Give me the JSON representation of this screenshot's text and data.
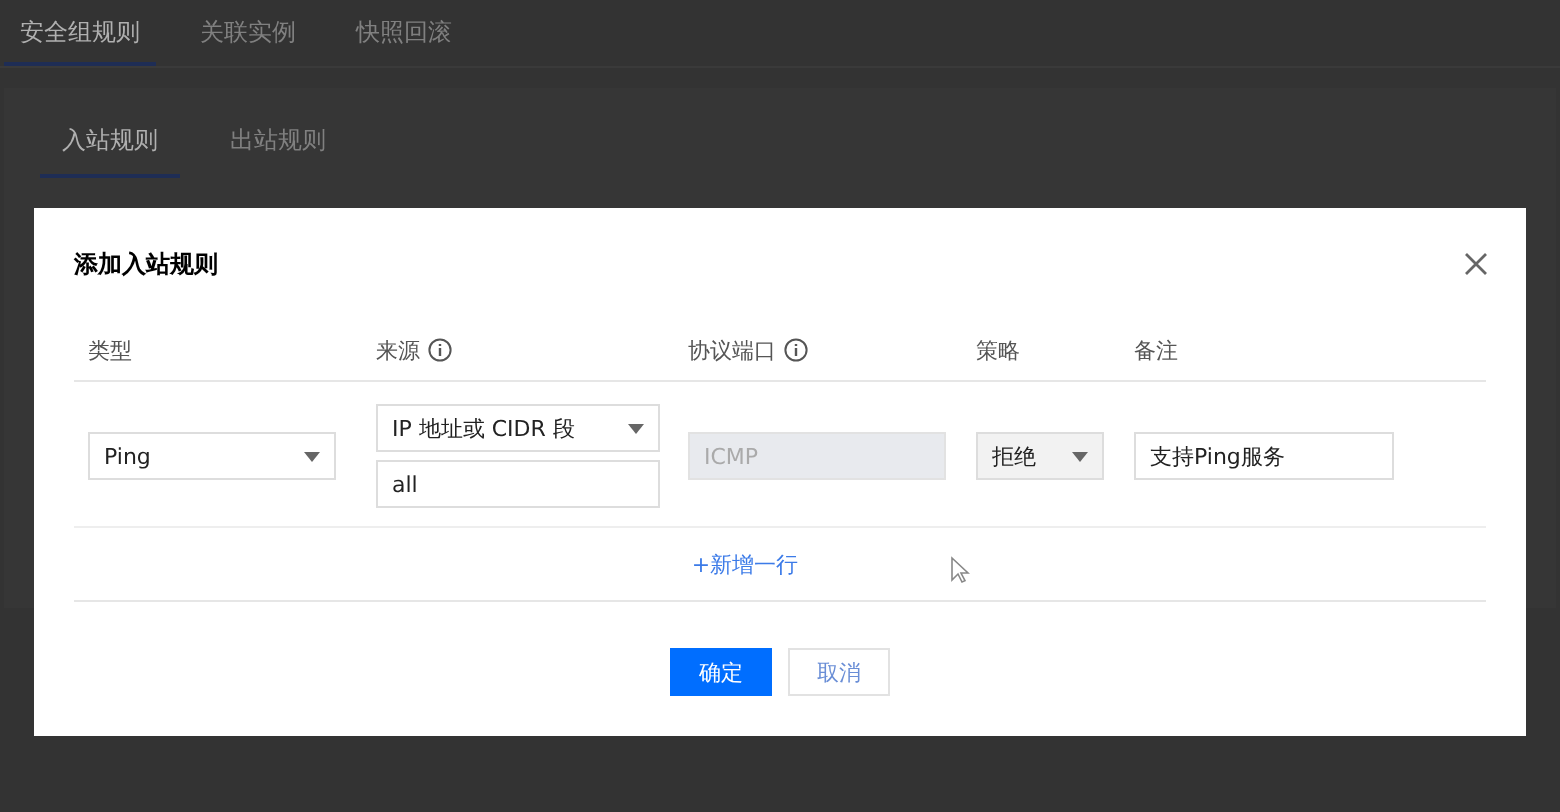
{
  "tabs": [
    {
      "label": "安全组规则",
      "selected": true
    },
    {
      "label": "关联实例",
      "selected": false
    },
    {
      "label": "快照回滚",
      "selected": false
    }
  ],
  "sub_tabs": [
    {
      "label": "入站规则",
      "selected": true
    },
    {
      "label": "出站规则",
      "selected": false
    }
  ],
  "dialog": {
    "title": "添加入站规则",
    "columns": [
      {
        "label": "类型",
        "info": false
      },
      {
        "label": "来源",
        "info": true
      },
      {
        "label": "协议端口",
        "info": true
      },
      {
        "label": "策略",
        "info": false
      },
      {
        "label": "备注",
        "info": false
      }
    ],
    "row": {
      "type": "Ping",
      "source_type": "IP 地址或 CIDR 段",
      "source": "all",
      "port": "ICMP",
      "policy": "拒绝",
      "note": "支持Ping服务"
    },
    "add_row": "+新增一行",
    "buttons": [
      {
        "label": "确定",
        "kind": "primary"
      },
      {
        "label": "取消",
        "kind": "secondary"
      }
    ]
  }
}
